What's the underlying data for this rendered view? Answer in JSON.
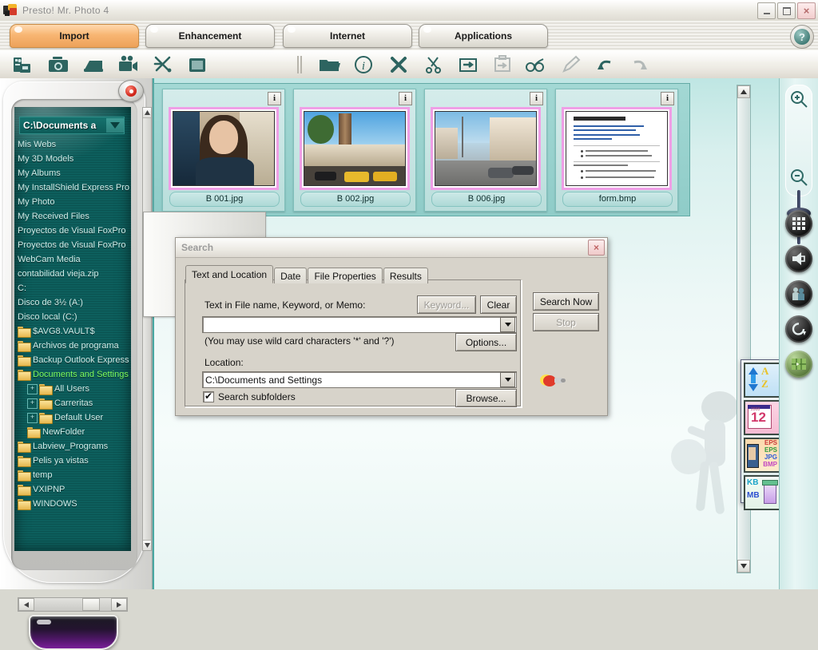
{
  "window": {
    "title": "Presto! Mr. Photo 4",
    "icon": "app-icon",
    "minimize": "–",
    "maximize": "❐",
    "close": "×"
  },
  "tabs": {
    "items": [
      {
        "label": "Import",
        "active": true
      },
      {
        "label": "Enhancement",
        "active": false
      },
      {
        "label": "Internet",
        "active": false
      },
      {
        "label": "Applications",
        "active": false
      }
    ],
    "help_label": "?"
  },
  "toolbar": {
    "left_tools": [
      {
        "name": "acquire-from-card-icon",
        "title": "Acquire from Card"
      },
      {
        "name": "camera-icon",
        "title": "Camera"
      },
      {
        "name": "scanner-icon",
        "title": "Scanner"
      },
      {
        "name": "video-camera-icon",
        "title": "Video Camera"
      },
      {
        "name": "tools-icon",
        "title": "Tools"
      },
      {
        "name": "screen-capture-icon",
        "title": "Screen Capture"
      }
    ],
    "right_tools": [
      {
        "name": "separator-icon",
        "title": "Separator"
      },
      {
        "name": "open-folder-icon",
        "title": "Open Folder"
      },
      {
        "name": "info-icon",
        "title": "Information"
      },
      {
        "name": "delete-icon",
        "title": "Delete"
      },
      {
        "name": "cut-icon",
        "title": "Cut"
      },
      {
        "name": "copy-icon",
        "title": "Copy"
      },
      {
        "name": "paste-icon",
        "title": "Paste"
      },
      {
        "name": "view-glasses-icon",
        "title": "View"
      },
      {
        "name": "edit-pencil-icon",
        "title": "Edit"
      },
      {
        "name": "undo-icon",
        "title": "Undo"
      },
      {
        "name": "redo-icon",
        "title": "Redo"
      }
    ]
  },
  "sidebar": {
    "path_value": "C:\\Documents a",
    "dropdown_icon": "chevron-down-icon",
    "tree": [
      {
        "label": "Mis Webs",
        "type": "text",
        "depth": 0,
        "expander": false,
        "selected": false
      },
      {
        "label": "My 3D Models",
        "type": "text",
        "depth": 0,
        "expander": false,
        "selected": false
      },
      {
        "label": "My Albums",
        "type": "text",
        "depth": 0,
        "expander": false,
        "selected": false
      },
      {
        "label": "My InstallShield Express Pro",
        "type": "text",
        "depth": 0,
        "expander": false,
        "selected": false
      },
      {
        "label": "My Photo",
        "type": "text",
        "depth": 0,
        "expander": false,
        "selected": false
      },
      {
        "label": "My Received Files",
        "type": "text",
        "depth": 0,
        "expander": false,
        "selected": false
      },
      {
        "label": "Proyectos de Visual FoxPro",
        "type": "text",
        "depth": 0,
        "expander": false,
        "selected": false
      },
      {
        "label": "Proyectos de Visual FoxPro",
        "type": "text",
        "depth": 0,
        "expander": false,
        "selected": false
      },
      {
        "label": "WebCam Media",
        "type": "text",
        "depth": 0,
        "expander": false,
        "selected": false
      },
      {
        "label": "contabilidad vieja.zip",
        "type": "text",
        "depth": 0,
        "expander": false,
        "selected": false
      },
      {
        "label": "C:",
        "type": "text",
        "depth": 0,
        "expander": false,
        "selected": false
      },
      {
        "label": "Disco de 3½ (A:)",
        "type": "text",
        "depth": 0,
        "expander": false,
        "selected": false
      },
      {
        "label": "Disco local (C:)",
        "type": "text",
        "depth": 0,
        "expander": false,
        "selected": false
      },
      {
        "label": "$AVG8.VAULT$",
        "type": "folder",
        "depth": 0,
        "expander": false,
        "selected": false
      },
      {
        "label": "Archivos de programa",
        "type": "folder",
        "depth": 0,
        "expander": false,
        "selected": false
      },
      {
        "label": "Backup Outlook Express",
        "type": "folder",
        "depth": 0,
        "expander": false,
        "selected": false
      },
      {
        "label": "Documents and Settings",
        "type": "folder",
        "depth": 0,
        "expander": false,
        "selected": true
      },
      {
        "label": "All Users",
        "type": "folder",
        "depth": 1,
        "expander": true,
        "selected": false
      },
      {
        "label": "Carreritas",
        "type": "folder",
        "depth": 1,
        "expander": true,
        "selected": false
      },
      {
        "label": "Default User",
        "type": "folder",
        "depth": 1,
        "expander": true,
        "selected": false
      },
      {
        "label": "NewFolder",
        "type": "folder",
        "depth": 1,
        "expander": false,
        "selected": false
      },
      {
        "label": "Labview_Programs",
        "type": "folder",
        "depth": 0,
        "expander": false,
        "selected": false
      },
      {
        "label": "Pelis ya vistas",
        "type": "folder",
        "depth": 0,
        "expander": false,
        "selected": false
      },
      {
        "label": "temp",
        "type": "folder",
        "depth": 0,
        "expander": false,
        "selected": false
      },
      {
        "label": "VXIPNP",
        "type": "folder",
        "depth": 0,
        "expander": false,
        "selected": false
      },
      {
        "label": "WINDOWS",
        "type": "folder",
        "depth": 0,
        "expander": false,
        "selected": false
      }
    ],
    "expander_glyph": "+",
    "scroll_up": "▲",
    "scroll_down": "▼",
    "scroll_left": "◄",
    "scroll_right": "►"
  },
  "thumbnails": {
    "info_badge": "i",
    "items": [
      {
        "caption": "B 001.jpg",
        "art": "p-portrait"
      },
      {
        "caption": "B 002.jpg",
        "art": "p-city"
      },
      {
        "caption": "B 006.jpg",
        "art": "p-street"
      },
      {
        "caption": "form.bmp",
        "art": "p-doc"
      }
    ]
  },
  "search_dialog": {
    "title": "Search",
    "close_label": "×",
    "tabs": [
      {
        "label": "Text and Location",
        "active": true
      },
      {
        "label": "Date",
        "active": false
      },
      {
        "label": "File Properties",
        "active": false
      },
      {
        "label": "Results",
        "active": false
      }
    ],
    "text_label": "Text in File name, Keyword, or Memo:",
    "keyword_button": "Keyword...",
    "keyword_enabled": false,
    "clear_button": "Clear",
    "search_value": "",
    "wildcard_hint": "(You may use wild card characters '*' and '?')",
    "options_button": "Options...",
    "location_label": "Location:",
    "location_value": "C:\\Documents and Settings",
    "subfolders_label": "Search subfolders",
    "subfolders_checked": true,
    "check_glyph": "✔",
    "browse_button": "Browse...",
    "search_now_button": "Search Now",
    "stop_button": "Stop",
    "stop_enabled": false,
    "flashlight_icon": "flashlight-icon"
  },
  "right_rail": {
    "zoom_in_icon": "zoom-in-icon",
    "zoom_out_icon": "zoom-out-icon",
    "zoom_slider": "zoom-slider",
    "buttons": [
      {
        "name": "thumbnail-grid-view-icon"
      },
      {
        "name": "slideshow-icon"
      },
      {
        "name": "people-icon"
      },
      {
        "name": "rotate-icon"
      },
      {
        "name": "map-icon"
      }
    ]
  },
  "sort_palette": {
    "items": [
      {
        "name": "sort-alphabetical-icon",
        "labels": [
          "A",
          "Z"
        ]
      },
      {
        "name": "sort-by-date-icon",
        "labels": [
          "2008",
          "12"
        ]
      },
      {
        "name": "sort-by-filetype-icon",
        "labels": [
          "EPS",
          "EPS",
          "JPG",
          "BMP"
        ]
      },
      {
        "name": "sort-by-size-icon",
        "labels": [
          "KB",
          "MB"
        ]
      }
    ]
  }
}
